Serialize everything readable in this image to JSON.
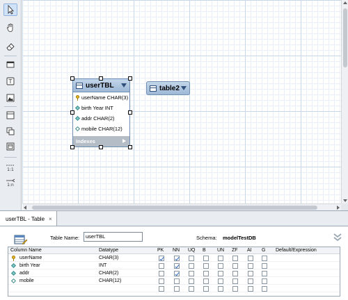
{
  "toolbar": {
    "tools": [
      {
        "name": "pointer-tool",
        "icon": "cursor-icon",
        "active": true
      },
      {
        "name": "hand-tool",
        "icon": "hand-icon"
      },
      {
        "name": "eraser-tool",
        "icon": "eraser-icon"
      },
      {
        "name": "layer-tool",
        "icon": "layer-icon"
      },
      {
        "name": "text-tool",
        "icon": "text-object-icon"
      },
      {
        "name": "image-tool",
        "icon": "image-icon"
      },
      {
        "name": "table-tool",
        "icon": "table-icon"
      },
      {
        "name": "view-tool",
        "icon": "view-icon"
      },
      {
        "name": "routine-tool",
        "icon": "routine-group-icon"
      }
    ],
    "relationships": [
      {
        "label": "1:1"
      },
      {
        "label": "1:n"
      }
    ]
  },
  "diagram": {
    "entity1": {
      "title": "userTBL",
      "columns": [
        {
          "text": "userName CHAR(3)",
          "icon": "key-icon"
        },
        {
          "text": "birth Year INT",
          "icon": "diamond-icon"
        },
        {
          "text": "addr CHAR(2)",
          "icon": "diamond-icon"
        },
        {
          "text": "mobile CHAR(12)",
          "icon": "diamond-hollow-icon"
        }
      ],
      "indexes_label": "Indexes"
    },
    "entity2": {
      "title": "table2"
    }
  },
  "editor": {
    "tab_label": "userTBL - Table",
    "tab_close": "×",
    "table_name_label": "Table Name:",
    "table_name_value": "userTBL",
    "schema_label": "Schema:",
    "schema_value": "modelTestDB",
    "grid_headers": [
      "Column Name",
      "Datatype",
      "PK",
      "NN",
      "UQ",
      "B",
      "UN",
      "ZF",
      "AI",
      "G",
      "Default/Expression"
    ],
    "rows": [
      {
        "name": "userName",
        "type": "CHAR(3)",
        "icon": "key-icon",
        "pk": true,
        "nn": true
      },
      {
        "name": "birth Year",
        "type": "INT",
        "icon": "diamond-icon",
        "pk": false,
        "nn": true
      },
      {
        "name": "addr",
        "type": "CHAR(2)",
        "icon": "diamond-icon",
        "pk": false,
        "nn": true
      },
      {
        "name": "mobile",
        "type": "CHAR(12)",
        "icon": "diamond-hollow-icon",
        "pk": false,
        "nn": false
      },
      {
        "name": "",
        "type": "",
        "icon": "",
        "pk": false,
        "nn": false
      }
    ]
  },
  "colors": {
    "entity_header": "#9db8d6",
    "canvas_grid": "#c9d6e6",
    "check": "#2e6bbf"
  }
}
